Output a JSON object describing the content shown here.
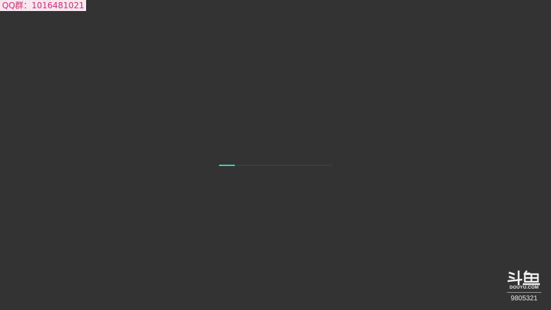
{
  "overlay": {
    "qq_text": "QQ群：1016481021"
  },
  "loader": {
    "progress": 0.14,
    "fill_color": "#4ad0b0"
  },
  "watermark": {
    "logo_text": "斗鱼",
    "brand_text": "DOUYU.COM",
    "room_id": "9805321"
  },
  "colors": {
    "background": "#333333",
    "banner_bg": "#f8e9ee",
    "banner_text": "#e4257a"
  }
}
